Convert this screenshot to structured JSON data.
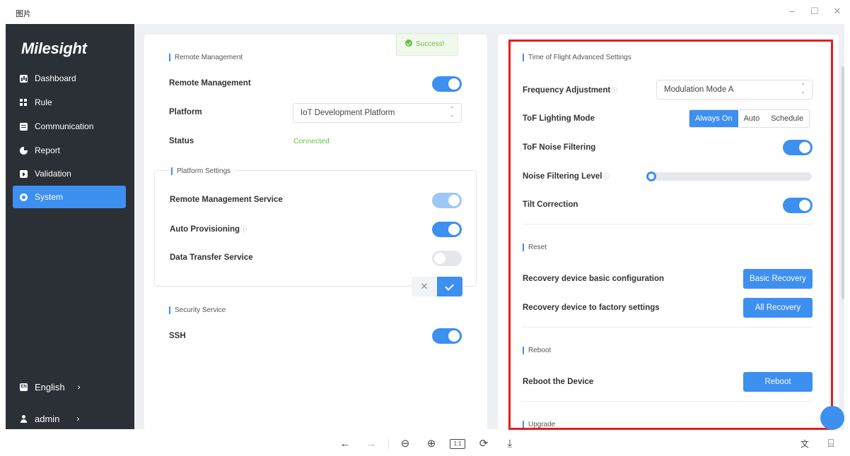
{
  "window": {
    "title": "图片",
    "minimize": "–",
    "maximize": "☐",
    "close": "✕"
  },
  "sidebar": {
    "logo": "Milesight",
    "items": [
      {
        "label": "Dashboard",
        "icon": "dashboard-icon"
      },
      {
        "label": "Rule",
        "icon": "rule-icon"
      },
      {
        "label": "Communication",
        "icon": "communication-icon"
      },
      {
        "label": "Report",
        "icon": "report-icon"
      },
      {
        "label": "Validation",
        "icon": "validation-icon"
      },
      {
        "label": "System",
        "icon": "gear-icon",
        "active": true
      }
    ],
    "language": "English",
    "language_icon": "EN",
    "user": "admin",
    "chevron": "›"
  },
  "left_panel": {
    "toast": "Success!",
    "remote_section": "Remote Management",
    "remote_management_label": "Remote Management",
    "remote_management_on": true,
    "platform_label": "Platform",
    "platform_value": "IoT Development Platform",
    "status_label": "Status",
    "status_value": "Connected",
    "platform_settings_section": "Platform Settings",
    "remote_service_label": "Remote Management Service",
    "remote_service_on": true,
    "auto_provisioning_label": "Auto Provisioning",
    "auto_provisioning_on": true,
    "data_transfer_label": "Data Transfer Service",
    "data_transfer_on": false,
    "cancel_glyph": "✕",
    "security_section": "Security Service",
    "ssh_label": "SSH",
    "ssh_on": true
  },
  "right_panel": {
    "tof_section": "Time of Flight Advanced Settings",
    "frequency_label": "Frequency Adjustment",
    "frequency_value": "Modulation Mode A",
    "lighting_label": "ToF Lighting Mode",
    "lighting_options": [
      "Always On",
      "Auto",
      "Schedule"
    ],
    "lighting_selected": "Always On",
    "noise_filter_label": "ToF Noise Filtering",
    "noise_filter_on": true,
    "noise_level_label": "Noise Filtering Level",
    "noise_level_value": 0,
    "tilt_label": "Tilt Correction",
    "tilt_on": true,
    "reset_section": "Reset",
    "basic_recovery_label": "Recovery device basic configuration",
    "basic_recovery_button": "Basic Recovery",
    "factory_label": "Recovery device to factory settings",
    "factory_button": "All Recovery",
    "reboot_section": "Reboot",
    "reboot_label": "Reboot the Device",
    "reboot_button": "Reboot",
    "upgrade_section": "Upgrade",
    "help_icon": "ⓘ",
    "arrows_up": "⌃",
    "arrows_down": "⌄"
  },
  "colors": {
    "accent": "#3d8ff0",
    "sidebar_bg": "#2b2f36",
    "success": "#67c23a",
    "highlight_frame": "#e81c1c"
  },
  "viewer_toolbar": {
    "prev": "←",
    "next": "→",
    "zoom_out": "⊖",
    "zoom_in": "⊕",
    "actual_size": "1:1",
    "rotate": "⟳",
    "download": "⤓",
    "translate_icon": "文",
    "ocr_icon": "⌸"
  }
}
